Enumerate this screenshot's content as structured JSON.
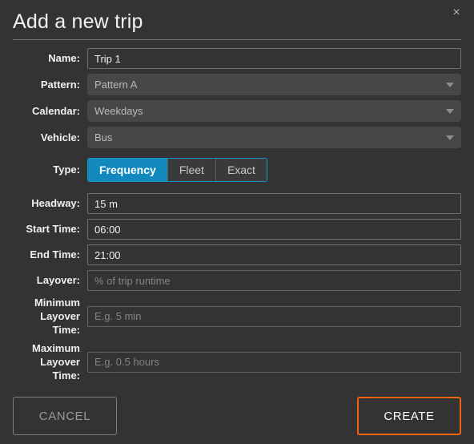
{
  "dialog": {
    "title": "Add a new trip",
    "close_icon": "close-icon",
    "close_glyph": "×"
  },
  "form": {
    "fields": [
      {
        "label": "Name:",
        "value": "Trip 1",
        "placeholder": "",
        "kind": "text"
      },
      {
        "label": "Pattern:",
        "value": "Pattern A",
        "placeholder": "",
        "kind": "select"
      },
      {
        "label": "Calendar:",
        "value": "Weekdays",
        "placeholder": "",
        "kind": "select"
      },
      {
        "label": "Vehicle:",
        "value": "Bus",
        "placeholder": "",
        "kind": "select"
      }
    ],
    "type_row": {
      "label": "Type:",
      "options": [
        "Frequency",
        "Fleet",
        "Exact"
      ],
      "selected": "Frequency"
    },
    "schedule_fields": [
      {
        "label": "Headway:",
        "value": "15 m",
        "placeholder": ""
      },
      {
        "label": "Start Time:",
        "value": "06:00",
        "placeholder": ""
      },
      {
        "label": "End Time:",
        "value": "21:00",
        "placeholder": ""
      },
      {
        "label": "Layover:",
        "value": "",
        "placeholder": "% of trip runtime"
      }
    ],
    "layover_min": {
      "label_line1": "Minimum",
      "label_line2": "Layover Time:",
      "value": "",
      "placeholder": "E.g. 5 min"
    },
    "layover_max": {
      "label_line1": "Maximum",
      "label_line2": "Layover Time:",
      "value": "",
      "placeholder": "E.g. 0.5 hours"
    }
  },
  "footer": {
    "cancel_label": "CANCEL",
    "create_label": "CREATE"
  },
  "colors": {
    "background": "#333333",
    "accent_blue": "#1289bd",
    "accent_orange": "#f06311",
    "field_gray": "#474747",
    "text": "#f0f0f0",
    "muted_text": "#9a9a9a"
  }
}
